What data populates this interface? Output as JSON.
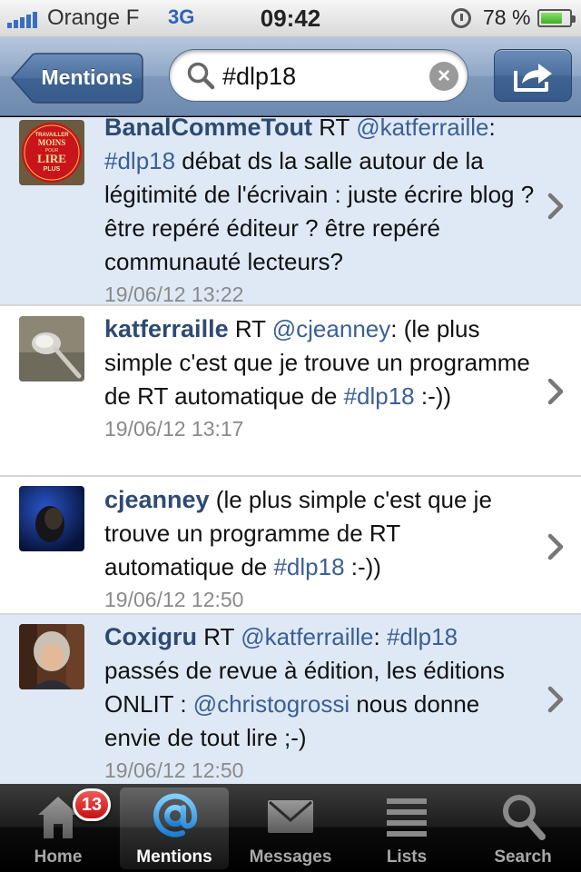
{
  "status_bar": {
    "carrier": "Orange F",
    "network": "3G",
    "time": "09:42",
    "battery_percent": "78 %"
  },
  "nav": {
    "back_label": "Mentions",
    "search_query": "#dlp18"
  },
  "tweets": [
    {
      "user": "BanalCommeTout",
      "segments": [
        {
          "text": " RT ",
          "type": "text"
        },
        {
          "text": "@katferraille",
          "type": "link"
        },
        {
          "text": ": ",
          "type": "text"
        },
        {
          "text": "#dlp18",
          "type": "link"
        },
        {
          "text": "  débat ds la salle autour de la légitimité de l'écrivain : juste écrire blog ? être repéré éditeur ? être repéré communauté lecteurs?",
          "type": "text"
        }
      ],
      "time": "19/06/12 13:22",
      "highlighted": true
    },
    {
      "user": "katferraille",
      "segments": [
        {
          "text": " RT ",
          "type": "text"
        },
        {
          "text": "@cjeanney",
          "type": "link"
        },
        {
          "text": ": (le plus simple c'est que je trouve un programme de RT automatique de ",
          "type": "text"
        },
        {
          "text": "#dlp18",
          "type": "link"
        },
        {
          "text": " :-))",
          "type": "text"
        }
      ],
      "time": "19/06/12 13:17",
      "highlighted": false
    },
    {
      "user": "cjeanney",
      "segments": [
        {
          "text": " (le plus simple c'est que je trouve un programme de RT automatique de ",
          "type": "text"
        },
        {
          "text": "#dlp18",
          "type": "link"
        },
        {
          "text": " :-))",
          "type": "text"
        }
      ],
      "time": "19/06/12 12:50",
      "highlighted": false
    },
    {
      "user": "Coxigru",
      "segments": [
        {
          "text": " RT ",
          "type": "text"
        },
        {
          "text": "@katferraille",
          "type": "link"
        },
        {
          "text": ": ",
          "type": "text"
        },
        {
          "text": "#dlp18",
          "type": "link"
        },
        {
          "text": " passés de revue à édition, les éditions ONLIT : ",
          "type": "text"
        },
        {
          "text": "@christogrossi",
          "type": "link"
        },
        {
          "text": " nous donne envie de tout lire ;-)",
          "type": "text"
        }
      ],
      "time": "19/06/12 12:50",
      "highlighted": true
    }
  ],
  "avatar_1_text": [
    "TRAVAILLER",
    "MOINS",
    "POUR",
    "LIRE",
    "PLUS"
  ],
  "tab_bar": {
    "tabs": [
      {
        "label": "Home",
        "icon": "home-icon",
        "badge": "13"
      },
      {
        "label": "Mentions",
        "icon": "at-icon",
        "active": true
      },
      {
        "label": "Messages",
        "icon": "envelope-icon"
      },
      {
        "label": "Lists",
        "icon": "list-icon"
      },
      {
        "label": "Search",
        "icon": "magnifier-icon"
      }
    ]
  },
  "colors": {
    "link": "#3b5f95",
    "username": "#2e4a72",
    "highlight_row": "#dfe9f6",
    "badge": "#d42020"
  }
}
